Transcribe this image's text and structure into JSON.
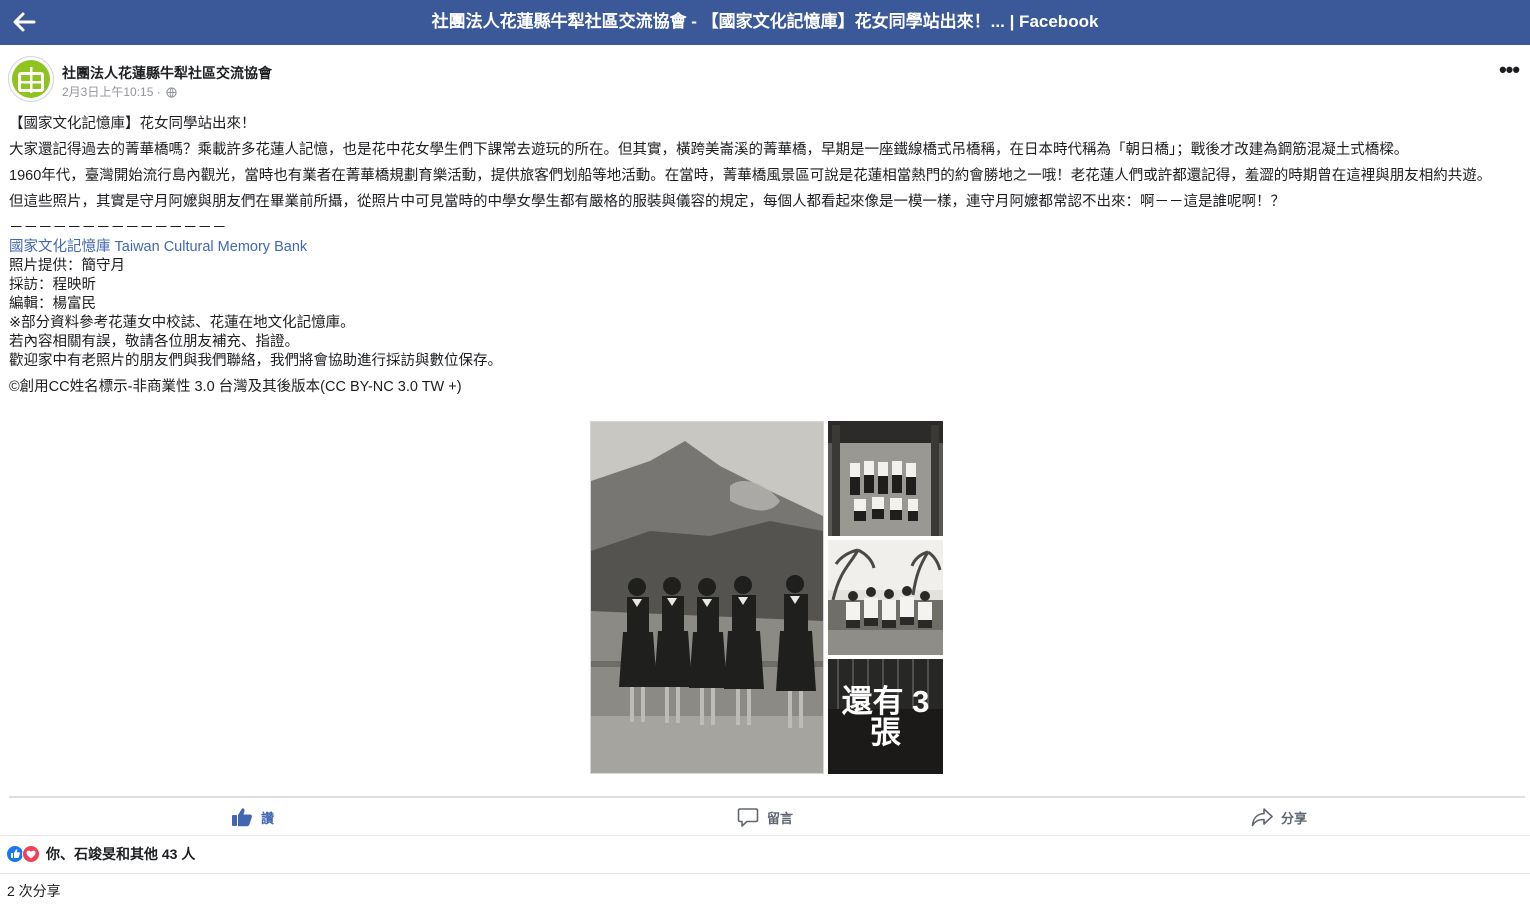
{
  "topbar": {
    "title": "社團法人花蓮縣牛犁社區交流協會 - 【國家文化記憶庫】花女同學站出來！... | Facebook",
    "color": "#3b5998"
  },
  "post": {
    "author": "社團法人花蓮縣牛犁社區交流協會",
    "time": "2月3日上午10:15 · ",
    "paragraphs": [
      "【國家文化記憶庫】花女同學站出來！",
      "大家還記得過去的菁華橋嗎？乘載許多花蓮人記憶，也是花中花女學生們下課常去遊玩的所在。但其實，橫跨美崙溪的菁華橋，早期是一座鐵線橋式吊橋稱，在日本時代稱為「朝日橋」；戰後才改建為鋼筋混凝土式橋樑。",
      "1960年代，臺灣開始流行島內觀光，當時也有業者在菁華橋規劃育樂活動，提供旅客們划船等地活動。在當時，菁華橋風景區可說是花蓮相當熱門的約會勝地之一哦！老花蓮人們或許都還記得，羞澀的時期曾在這裡與朋友相約共遊。",
      "但這些照片，其實是守月阿嬤與朋友們在畢業前所攝，從照片中可見當時的中學女學生都有嚴格的服裝與儀容的規定，每個人都看起來像是一模一樣，連守月阿嬤都常認不出來：啊－－這是誰呢啊！？"
    ],
    "separator": "－－－－－－－－－－－－－－－",
    "link_text": "國家文化記憶庫 Taiwan Cultural Memory Bank",
    "credits": [
      "照片提供：簡守月",
      "採訪：程映昕",
      "編輯：楊富民",
      "※部分資料參考花蓮女中校誌、花蓮在地文化記憶庫。",
      "若內容相關有誤，敬請各位朋友補充、指證。",
      "歡迎家中有老照片的朋友們與我們聯絡，我們將會協助進行採訪與數位保存。"
    ],
    "license": "©創用CC姓名標示-非商業性 3.0 台灣及其後版本(CC BY-NC 3.0 TW +)",
    "more_photos": "還有 3 張"
  },
  "actions": {
    "like": "讚",
    "comment": "留言",
    "share": "分享",
    "like_color": "#4267b2"
  },
  "reactions": {
    "text": "你、石竣旻和其他 43 人"
  },
  "shares": "2 次分享"
}
